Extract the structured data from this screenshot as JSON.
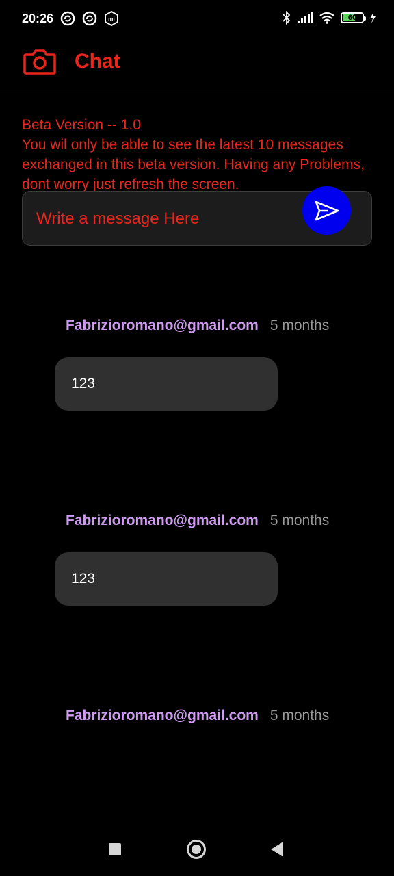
{
  "status_bar": {
    "time": "20:26",
    "battery_level": "60",
    "left_icons": [
      "sync-icon",
      "sync-icon",
      "mi-icon"
    ],
    "right_icons": [
      "bluetooth-icon",
      "signal-icon",
      "wifi-icon",
      "battery-icon",
      "charging-icon"
    ]
  },
  "app_bar": {
    "icon": "camera-icon",
    "title": "Chat"
  },
  "notice": {
    "version": "Beta Version -- 1.0",
    "message": "You wil only be able to see the latest 10 messages exchanged in this beta version. Having any Problems, dont worry just refresh the screen."
  },
  "composer": {
    "placeholder": "Write a message Here",
    "value": "",
    "send_icon": "send-icon"
  },
  "messages": [
    {
      "sender": "Fabrizioromano@gmail.com",
      "time": "5 months",
      "text": "123"
    },
    {
      "sender": "Fabrizioromano@gmail.com",
      "time": "5 months",
      "text": "123"
    },
    {
      "sender": "Fabrizioromano@gmail.com",
      "time": "5 months"
    }
  ],
  "nav_bar": {
    "buttons": [
      "recents-button",
      "home-button",
      "back-button"
    ]
  },
  "colors": {
    "accent": "#e8261c",
    "sender": "#cf9bf2",
    "send_button": "#0000ee",
    "background": "#000000",
    "bubble": "#303030"
  }
}
